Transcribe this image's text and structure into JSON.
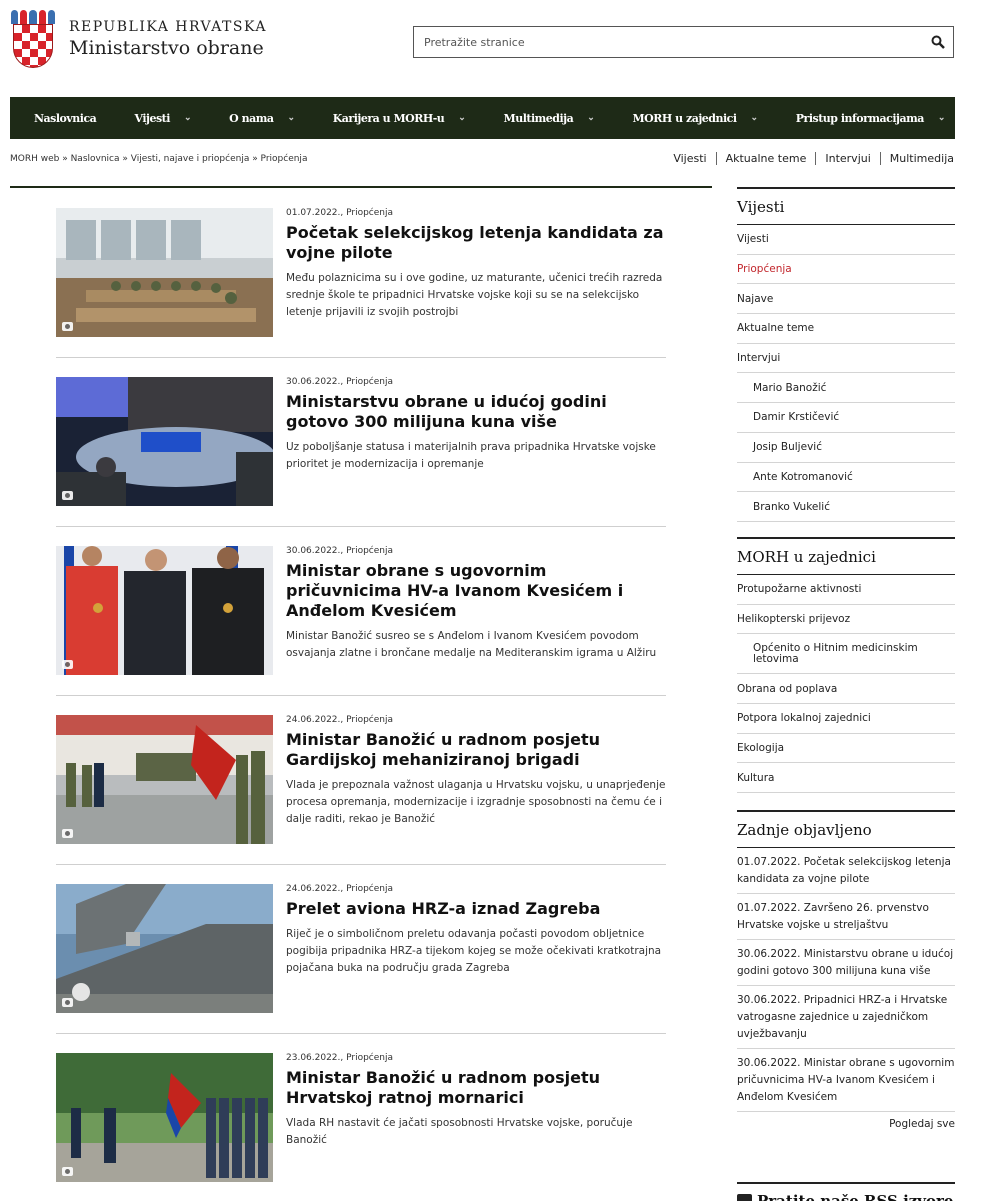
{
  "header": {
    "line1": "REPUBLIKA HRVATSKA",
    "line2": "Ministarstvo obrane",
    "search_placeholder": "Pretražite stranice"
  },
  "nav": [
    {
      "label": "Naslovnica",
      "caret": ""
    },
    {
      "label": "Vijesti",
      "caret": "⌄"
    },
    {
      "label": "O nama",
      "caret": "⌄"
    },
    {
      "label": "Karijera u MORH-u",
      "caret": "⌄"
    },
    {
      "label": "Multimedija",
      "caret": "⌄"
    },
    {
      "label": "MORH u zajednici",
      "caret": "⌄"
    },
    {
      "label": "Pristup informacijama",
      "caret": "⌄"
    }
  ],
  "breadcrumb": "MORH web » Naslovnica » Vijesti, najave i priopćenja » Priopćenja",
  "quick_links": [
    "Vijesti",
    "Aktualne teme",
    "Intervjui",
    "Multimedija"
  ],
  "articles": [
    {
      "meta": "01.07.2022., Priopćenja",
      "title": "Početak selekcijskog letenja kandidata za vojne pilote",
      "excerpt": "Među polaznicima su i ove godine, uz maturante, učenici trećih razreda srednje škole te pripadnici Hrvatske vojske koji su se na selekcijsko letenje prijavili iz svojih postrojbi"
    },
    {
      "meta": "30.06.2022., Priopćenja",
      "title": "Ministarstvu obrane u idućoj godini gotovo 300 milijuna kuna više",
      "excerpt": "Uz poboljšanje statusa i materijalnih prava pripadnika Hrvatske vojske prioritet je modernizacija i opremanje"
    },
    {
      "meta": "30.06.2022., Priopćenja",
      "title": "Ministar obrane s ugovornim pričuvnicima HV-a Ivanom Kvesićem i Anđelom Kvesićem",
      "excerpt": "Ministar Banožić susreo se s Anđelom i Ivanom Kvesićem povodom osvajanja zlatne i brončane medalje na Mediteranskim igrama u Alžiru"
    },
    {
      "meta": "24.06.2022., Priopćenja",
      "title": "Ministar Banožić u radnom posjetu Gardijskoj mehaniziranoj brigadi",
      "excerpt": "Vlada je prepoznala važnost ulaganja u Hrvatsku vojsku, u unaprjeđenje procesa opremanja, modernizacije i izgradnje sposobnosti na čemu će i dalje raditi, rekao je Banožić"
    },
    {
      "meta": "24.06.2022., Priopćenja",
      "title": "Prelet aviona HRZ-a iznad Zagreba",
      "excerpt": "Riječ je o simboličnom preletu odavanja počasti povodom obljetnice pogibija pripadnika HRZ-a tijekom kojeg se može očekivati kratkotrajna pojačana buka na području grada Zagreba"
    },
    {
      "meta": "23.06.2022., Priopćenja",
      "title": "Ministar Banožić u radnom posjetu Hrvatskoj ratnoj mornarici",
      "excerpt": "Vlada RH nastavit će jačati sposobnosti Hrvatske vojske, poručuje Banožić"
    }
  ],
  "sidebar_news": {
    "heading": "Vijesti",
    "items": [
      {
        "label": "Vijesti",
        "active": false,
        "sub": false
      },
      {
        "label": "Priopćenja",
        "active": true,
        "sub": false
      },
      {
        "label": "Najave",
        "active": false,
        "sub": false
      },
      {
        "label": "Aktualne teme",
        "active": false,
        "sub": false
      },
      {
        "label": "Intervjui",
        "active": false,
        "sub": false
      },
      {
        "label": "Mario Banožić",
        "active": false,
        "sub": true
      },
      {
        "label": "Damir Krstičević",
        "active": false,
        "sub": true
      },
      {
        "label": "Josip Buljević",
        "active": false,
        "sub": true
      },
      {
        "label": "Ante Kotromanović",
        "active": false,
        "sub": true
      },
      {
        "label": "Branko Vukelić",
        "active": false,
        "sub": true
      }
    ]
  },
  "sidebar_community": {
    "heading": "MORH u zajednici",
    "items": [
      {
        "label": "Protupožarne aktivnosti",
        "sub": false
      },
      {
        "label": "Helikopterski prijevoz",
        "sub": false
      },
      {
        "label": "Općenito o Hitnim medicinskim letovima",
        "sub": true
      },
      {
        "label": "Obrana od poplava",
        "sub": false
      },
      {
        "label": "Potpora lokalnoj zajednici",
        "sub": false
      },
      {
        "label": "Ekologija",
        "sub": false
      },
      {
        "label": "Kultura",
        "sub": false
      }
    ]
  },
  "sidebar_recent": {
    "heading": "Zadnje objavljeno",
    "items": [
      "01.07.2022. Početak selekcijskog letenja kandidata za vojne pilote",
      "01.07.2022. Završeno 26. prvenstvo Hrvatske vojske u streljaštvu",
      "30.06.2022. Ministarstvu obrane u idućoj godini gotovo 300 milijuna kuna više",
      "30.06.2022. Pripadnici HRZ-a i Hrvatske vatrogasne zajednice u zajedničkom uvježbavanju",
      "30.06.2022. Ministar obrane s ugovornim pričuvnicima HV-a Ivanom Kvesićem i Anđelom Kvesićem"
    ],
    "see_all": "Pogledaj sve"
  },
  "rss_label": "Pratite naše RSS izvore",
  "colors": {
    "nav_bg": "#1e2a17",
    "active": "#c2272d",
    "crest_red": "#d8232a"
  }
}
